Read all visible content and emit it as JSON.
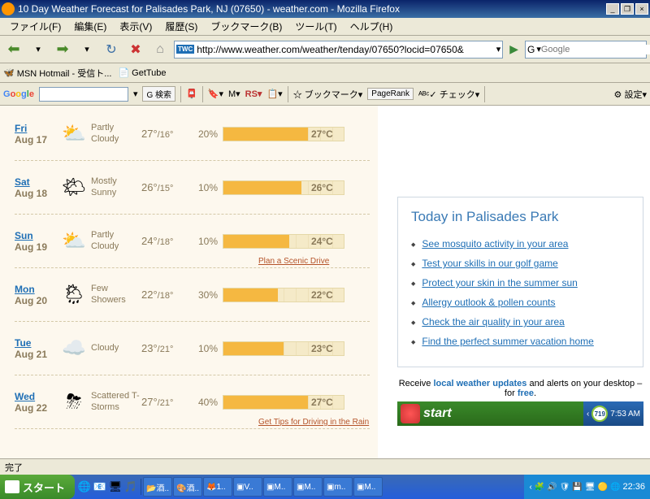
{
  "window": {
    "title": "10 Day Weather Forecast for Palisades Park, NJ (07650) - weather.com - Mozilla Firefox"
  },
  "menu": {
    "file": "ファイル(F)",
    "edit": "編集(E)",
    "view": "表示(V)",
    "history": "履歴(S)",
    "bookmarks": "ブックマーク(B)",
    "tools": "ツール(T)",
    "help": "ヘルプ(H)"
  },
  "url": {
    "value": "http://www.weather.com/weather/tenday/07650?locid=07650&",
    "twc": "TWC"
  },
  "search": {
    "engine": "G",
    "placeholder": "Google"
  },
  "bookmarks": {
    "msn": "MSN Hotmail - 受信ト...",
    "gettube": "GetTube"
  },
  "googlebar": {
    "search": "検索",
    "bookmark": "ブックマーク",
    "pagerank": "PageRank",
    "check": "チェック",
    "settings": "設定"
  },
  "forecast": [
    {
      "day": "Fri",
      "date": "Aug 17",
      "icon": "⛅",
      "cond": "Partly Cloudy",
      "hi": "27°",
      "lo": "/16°",
      "pct": "20%",
      "barw": "70%",
      "temp": "27°C",
      "link": ""
    },
    {
      "day": "Sat",
      "date": "Aug 18",
      "icon": "🌤",
      "cond": "Mostly Sunny",
      "hi": "26°",
      "lo": "/15°",
      "pct": "10%",
      "barw": "65%",
      "temp": "26°C",
      "link": ""
    },
    {
      "day": "Sun",
      "date": "Aug 19",
      "icon": "⛅",
      "cond": "Partly Cloudy",
      "hi": "24°",
      "lo": "/18°",
      "pct": "10%",
      "barw": "55%",
      "temp": "24°C",
      "link": "Plan a Scenic Drive"
    },
    {
      "day": "Mon",
      "date": "Aug 20",
      "icon": "🌦",
      "cond": "Few Showers",
      "hi": "22°",
      "lo": "/18°",
      "pct": "30%",
      "barw": "45%",
      "temp": "22°C",
      "link": ""
    },
    {
      "day": "Tue",
      "date": "Aug 21",
      "icon": "☁️",
      "cond": "Cloudy",
      "hi": "23°",
      "lo": "/21°",
      "pct": "10%",
      "barw": "50%",
      "temp": "23°C",
      "link": ""
    },
    {
      "day": "Wed",
      "date": "Aug 22",
      "icon": "⛈",
      "cond": "Scattered T-Storms",
      "hi": "27°",
      "lo": "/21°",
      "pct": "40%",
      "barw": "70%",
      "temp": "27°C",
      "link": "Get Tips for Driving in the Rain"
    }
  ],
  "sidebar": {
    "title": "Today in Palisades Park",
    "links": [
      "See mosquito activity in your area",
      "Test your skills in our golf game",
      "Protect your skin in the summer sun",
      "Allergy outlook & pollen counts",
      "Check the air quality in your area",
      "Find the perfect summer vacation home"
    ],
    "promo1": "Receive ",
    "promo2": "local weather updates",
    "promo3": " and alerts on your desktop – for ",
    "promo4": "free",
    "promo5": ".",
    "start": "start",
    "badge": "719",
    "time": "7:53 AM"
  },
  "status": "完了",
  "taskbar": {
    "start": "スタート",
    "clock": "22:36"
  }
}
